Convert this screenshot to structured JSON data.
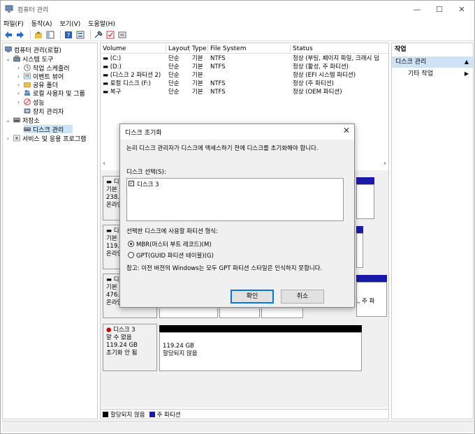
{
  "window": {
    "title": "컴퓨터 관리",
    "minimize": "—",
    "maximize": "☐",
    "close": "✕"
  },
  "menu": [
    "파일(F)",
    "동작(A)",
    "보기(V)",
    "도움말(H)"
  ],
  "tree": {
    "root": "컴퓨터 관리(로컬)",
    "system_tools": "시스템 도구",
    "task_scheduler": "작업 스케줄러",
    "event_viewer": "이벤트 뷰어",
    "shared_folders": "공유 폴더",
    "local_users": "로컬 사용자 및 그룹",
    "performance": "성능",
    "device_manager": "장치 관리자",
    "storage": "저장소",
    "disk_management": "디스크 관리",
    "services": "서비스 및 응용 프로그램"
  },
  "volumes": {
    "headers": [
      "Volume",
      "Layout",
      "Type",
      "File System",
      "Status"
    ],
    "rows": [
      [
        "(C:)",
        "단순",
        "기본",
        "NTFS",
        "정상 (부팅, 페이지 파일, 크래시 덤"
      ],
      [
        "(D:)",
        "단순",
        "기본",
        "NTFS",
        "정상 (활성, 주 파티션)"
      ],
      [
        "(디스크 2 파티션 2)",
        "단순",
        "기본",
        "",
        "정상 (EFI 시스템 파티션)"
      ],
      [
        "로컬 디스크 (F:)",
        "단순",
        "기본",
        "NTFS",
        "정상 (주 파티션)"
      ],
      [
        "복구",
        "단순",
        "기본",
        "NTFS",
        "정상 (OEM 파티션)"
      ]
    ]
  },
  "graph": {
    "disk0": {
      "l1": "디",
      "l2": "기본",
      "l3": "238.4",
      "l4": "온라인"
    },
    "disk1": {
      "l1": "디",
      "l2": "기본",
      "l3": "119.2",
      "l4": "온라인"
    },
    "disk2": {
      "l1": "디",
      "l2": "기본",
      "l3": "476.9",
      "l4": "온라인",
      "tail": "덤프, 주 파"
    },
    "disk3": {
      "name": "디스크 3",
      "l2": "알 수 없음",
      "l3": "119.24 GB",
      "l4": "초기화 안 됨",
      "part_size": "119.24 GB",
      "part_state": "할당되지 않음"
    }
  },
  "legend": {
    "unallocated": "할당되지 않음",
    "primary": "주 파티션"
  },
  "actions": {
    "header": "작업",
    "section": "디스크 관리",
    "more": "기타 작업"
  },
  "dialog": {
    "title": "디스크 초기화",
    "message": "논리 디스크 관리자가 디스크에 액세스하기 전에 디스크를 초기화해야 합니다.",
    "select_label": "디스크 선택(S):",
    "disk_item": "디스크 3",
    "style_label": "선택한 디스크에 사용할 파티션 형식:",
    "mbr": "MBR(마스터 부트 레코드)(M)",
    "gpt": "GPT(GUID 파티션 테이블)(G)",
    "note": "참고: 이전 버전의 Windows는 모두 GPT 파티션 스타일은 인식하지 못합니다.",
    "ok": "확인",
    "cancel": "취소",
    "selected_style": "MBR",
    "disk_checked": true
  },
  "colors": {
    "primary_partition": "#1a1aa8",
    "unallocated": "#000000",
    "selection": "#cce4f7",
    "accent": "#0078d7"
  }
}
